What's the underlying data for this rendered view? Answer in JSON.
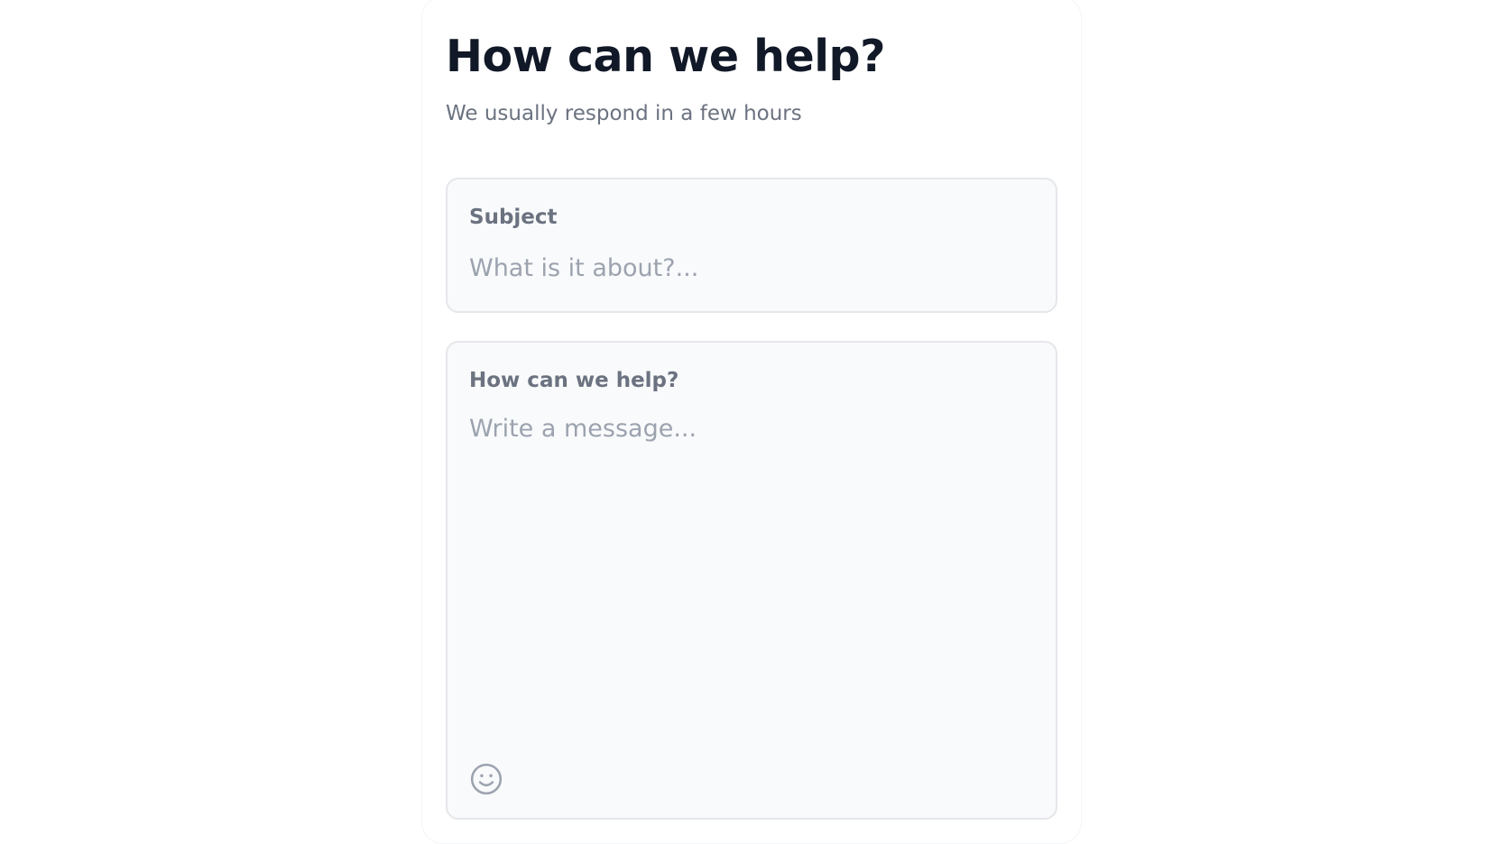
{
  "header": {
    "title": "How can we help?",
    "subtitle": "We usually respond in a few hours"
  },
  "form": {
    "subject": {
      "label": "Subject",
      "value": "",
      "placeholder": "What is it about?..."
    },
    "message": {
      "label": "How can we help?",
      "value": "",
      "placeholder": "Write a message..."
    },
    "emoji_button": {
      "icon": "smiley-face-icon"
    }
  },
  "colors": {
    "title": "#111827",
    "muted": "#6b7280",
    "placeholder": "#9ca3af",
    "field_background": "#f9fafb",
    "field_border": "#e5e7eb"
  }
}
